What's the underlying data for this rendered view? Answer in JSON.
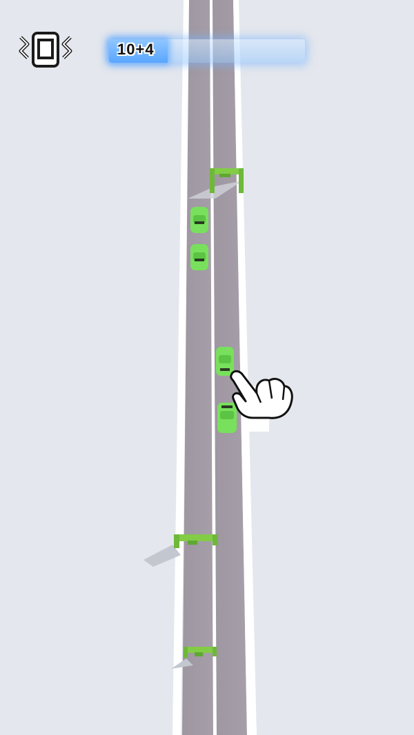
{
  "hud": {
    "vibration_icon": "vibration-phone-icon",
    "progress_label": "10+4",
    "progress_fraction": 0.3
  },
  "scene": {
    "road_color": "#a29aa3",
    "curb_color": "#ffffff",
    "car_color": "#78e05c",
    "gate_color": "#82cc46",
    "background_color": "#e4e7ed",
    "cars_count": 4,
    "gates_count": 3,
    "hint_icon": "tap-hand-icon"
  }
}
